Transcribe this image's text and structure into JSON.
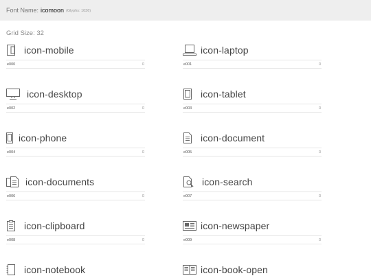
{
  "header": {
    "prefix": "Font Name:",
    "font_name": "icomoon",
    "glyph_count": "(Glyphs: 1036)"
  },
  "grid_size": "Grid Size: 32",
  "glyphs": [
    {
      "label": "icon-mobile",
      "code": "e000",
      "icon": "mobile-icon"
    },
    {
      "label": "icon-laptop",
      "code": "e001",
      "icon": "laptop-icon"
    },
    {
      "label": "icon-desktop",
      "code": "e002",
      "icon": "desktop-icon"
    },
    {
      "label": "icon-tablet",
      "code": "e003",
      "icon": "tablet-icon"
    },
    {
      "label": "icon-phone",
      "code": "e004",
      "icon": "phone-icon"
    },
    {
      "label": "icon-document",
      "code": "e005",
      "icon": "document-icon"
    },
    {
      "label": "icon-documents",
      "code": "e006",
      "icon": "documents-icon"
    },
    {
      "label": "icon-search",
      "code": "e007",
      "icon": "search-icon"
    },
    {
      "label": "icon-clipboard",
      "code": "e008",
      "icon": "clipboard-icon"
    },
    {
      "label": "icon-newspaper",
      "code": "e009",
      "icon": "newspaper-icon"
    },
    {
      "label": "icon-notebook",
      "code": "",
      "icon": "notebook-icon"
    },
    {
      "label": "icon-book-open",
      "code": "",
      "icon": "book-open-icon"
    }
  ]
}
